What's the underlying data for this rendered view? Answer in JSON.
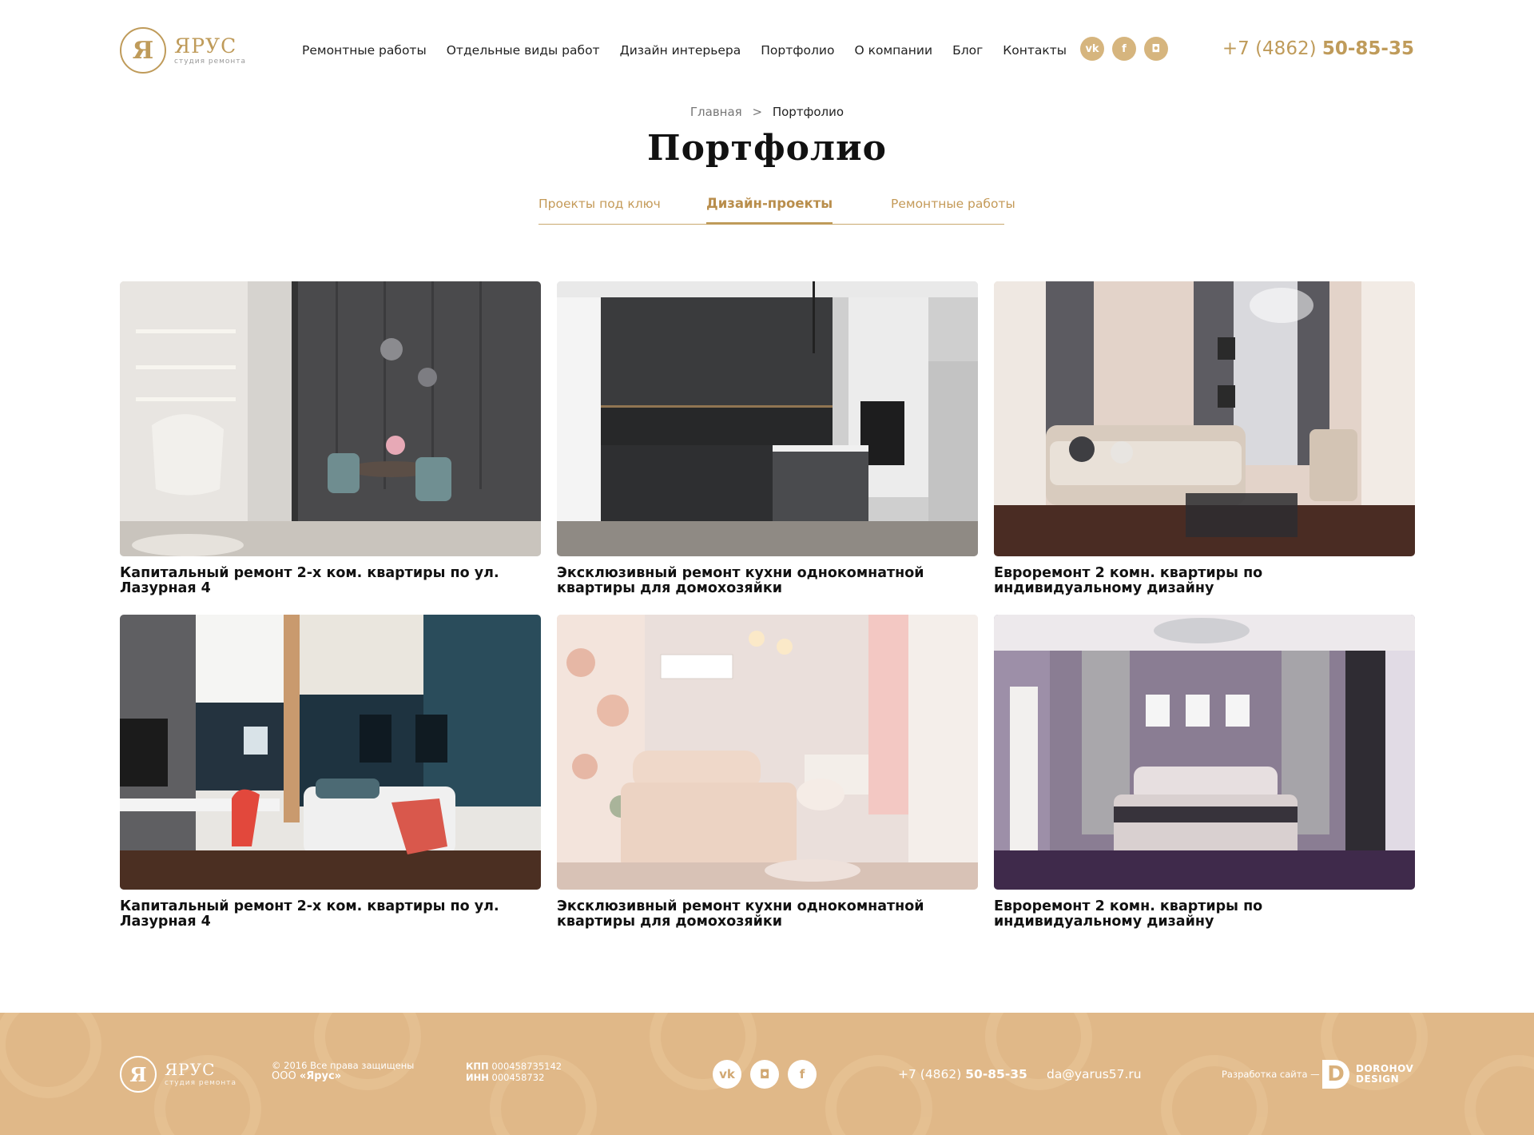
{
  "header": {
    "logo_name": "ЯРУС",
    "logo_sub": "студия ремонта",
    "nav": [
      "Ремонтные работы",
      "Отдельные виды работ",
      "Дизайн интерьера",
      "Портфолио",
      "О компании",
      "Блог",
      "Контакты"
    ],
    "socials": [
      {
        "icon": "vk-icon",
        "glyph": "vk"
      },
      {
        "icon": "facebook-icon",
        "glyph": "f"
      },
      {
        "icon": "instagram-icon",
        "glyph": "◘"
      }
    ],
    "phone_prefix": "+7 (4862)",
    "phone_main": "50-85-35"
  },
  "breadcrumb": {
    "home": "Главная",
    "separator": ">",
    "current": "Портфолио"
  },
  "page_title": "Портфолио",
  "tabs": [
    {
      "label": "Проекты под ключ",
      "active": false
    },
    {
      "label": "Дизайн-проекты",
      "active": true
    },
    {
      "label": "Ремонтные работы",
      "active": false
    }
  ],
  "projects": [
    {
      "title": "Капитальный ремонт 2-х ком. квартиры по ул. Лазурная 4",
      "image": "dark-living-dining-room"
    },
    {
      "title": "Эксклюзивный ремонт кухни однокомнатной квартиры для домохозяйки",
      "image": "dark-kitchen"
    },
    {
      "title": "Евроремонт 2 комн. квартиры по индивидуальному дизайну",
      "image": "beige-living-room"
    },
    {
      "title": "Капитальный ремонт 2-х ком. квартиры по ул. Лазурная 4",
      "image": "teen-room"
    },
    {
      "title": "Эксклюзивный ремонт кухни однокомнатной квартиры для домохозяйки",
      "image": "pink-girls-bedroom"
    },
    {
      "title": "Евроремонт 2 комн. квартиры по индивидуальному дизайну",
      "image": "lilac-bedroom"
    }
  ],
  "footer": {
    "logo_name": "ЯРУС",
    "logo_sub": "студия ремонта",
    "copyright": "© 2016 Все права защищены",
    "company_prefix": "ООО",
    "company_name": "«Ярус»",
    "kpp_label": "КПП",
    "kpp": "000458735142",
    "inn_label": "ИНН",
    "inn": "000458732",
    "socials": [
      {
        "icon": "vk-icon",
        "glyph": "vk"
      },
      {
        "icon": "instagram-icon",
        "glyph": "◘"
      },
      {
        "icon": "facebook-icon",
        "glyph": "f"
      }
    ],
    "phone_prefix": "+7 (4862)",
    "phone_main": "50-85-35",
    "email": "da@yarus57.ru",
    "developer_label": "Разработка сайта —",
    "developer_line1": "DOROHOV",
    "developer_line2": "DESIGN"
  },
  "colors": {
    "accent": "#bf9b5a",
    "footer_bg": "#e0b888"
  }
}
